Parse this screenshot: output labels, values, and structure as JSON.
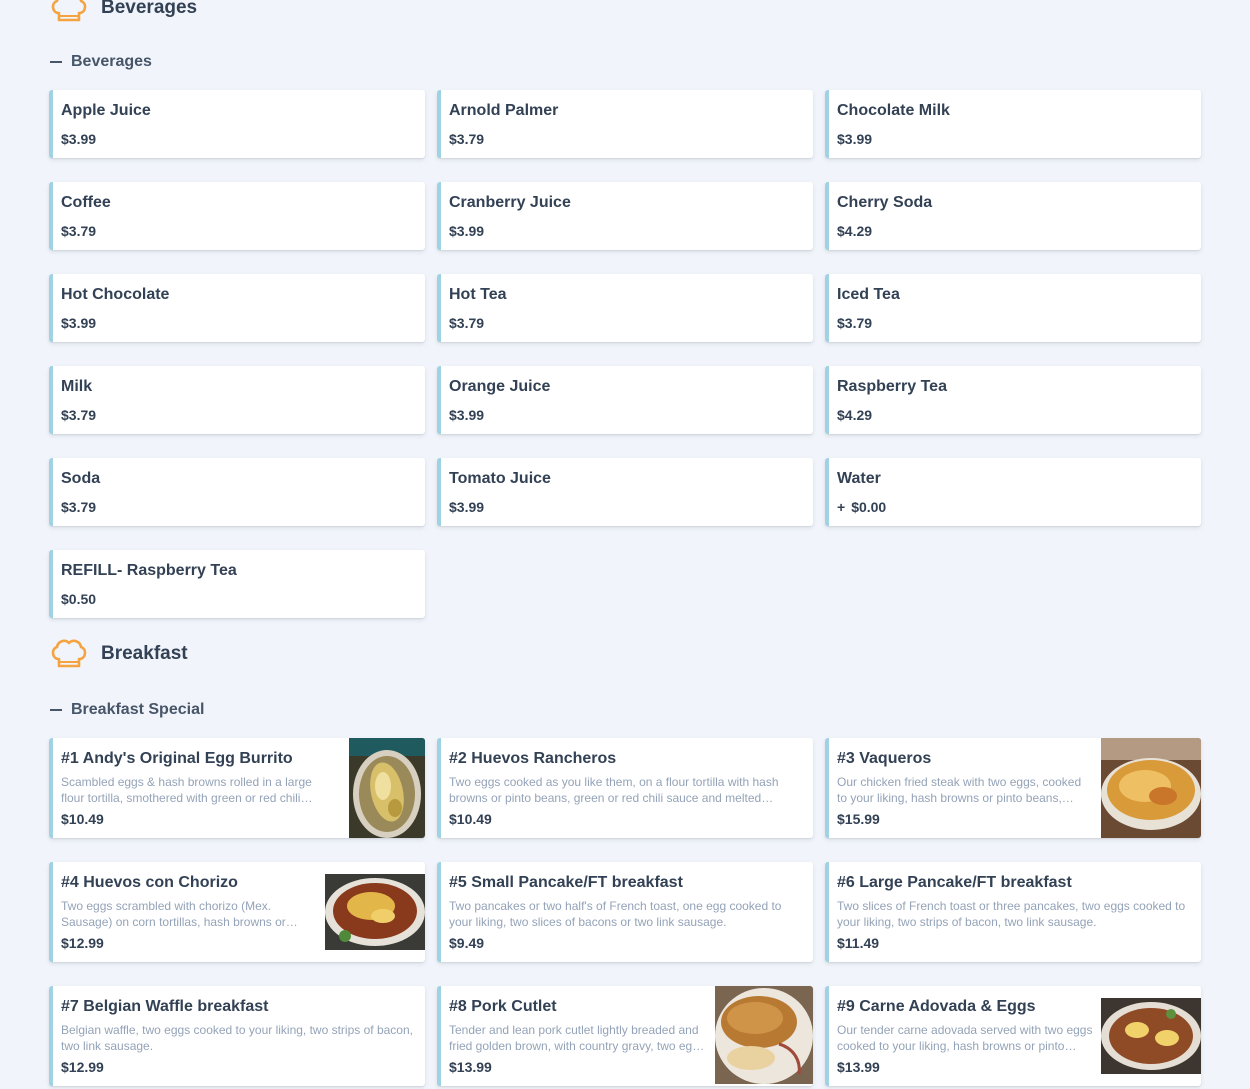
{
  "sections": {
    "beverages": {
      "title": "Beverages",
      "subcategory": "Beverages",
      "items": [
        {
          "name": "Apple Juice",
          "price": "$3.99"
        },
        {
          "name": "Arnold Palmer",
          "price": "$3.79"
        },
        {
          "name": "Chocolate Milk",
          "price": "$3.99"
        },
        {
          "name": "Coffee",
          "price": "$3.79"
        },
        {
          "name": "Cranberry Juice",
          "price": "$3.99"
        },
        {
          "name": "Cherry Soda",
          "price": "$4.29"
        },
        {
          "name": "Hot Chocolate",
          "price": "$3.99"
        },
        {
          "name": "Hot Tea",
          "price": "$3.79"
        },
        {
          "name": "Iced Tea",
          "price": "$3.79"
        },
        {
          "name": "Milk",
          "price": "$3.79"
        },
        {
          "name": "Orange Juice",
          "price": "$3.99"
        },
        {
          "name": "Raspberry Tea",
          "price": "$4.29"
        },
        {
          "name": "Soda",
          "price": "$3.79"
        },
        {
          "name": "Tomato Juice",
          "price": "$3.99"
        },
        {
          "name": "Water",
          "price_prefix": "+",
          "price": "$0.00"
        },
        {
          "name": "REFILL- Raspberry Tea",
          "price": "$0.50"
        }
      ]
    },
    "breakfast": {
      "title": "Breakfast",
      "subcategory": "Breakfast Special",
      "items": [
        {
          "name": "#1 Andy's Original Egg Burrito",
          "description": "Scambled eggs & hash browns rolled in a large flour tortilla, smothered with green or red chili sauce and melted cheese.",
          "price": "$10.49",
          "image": "egg-burrito-photo"
        },
        {
          "name": "#2 Huevos Rancheros",
          "description": "Two eggs cooked as you like them, on a flour tortilla with hash browns or pinto beans, green or red chili sauce and melted cheese.",
          "price": "$10.49"
        },
        {
          "name": "#3 Vaqueros",
          "description": "Our chicken fried steak with two eggs, cooked to your liking, hash browns or pinto beans, smothered in chili.",
          "price": "$15.99",
          "image": "vaqueros-photo"
        },
        {
          "name": "#4 Huevos con Chorizo",
          "description": "Two eggs scrambled with chorizo (Mex. Sausage) on corn tortillas, hash browns or pinto beans, smothered in chili.",
          "price": "$12.99",
          "image": "chorizo-photo"
        },
        {
          "name": "#5 Small Pancake/FT breakfast",
          "description": "Two pancakes or two half's of French toast, one egg cooked to your liking, two slices of bacons or two link sausage.",
          "price": "$9.49"
        },
        {
          "name": "#6 Large Pancake/FT breakfast",
          "description": "Two slices of French toast or three pancakes, two eggs cooked to your liking, two strips of bacon, two link sausage.",
          "price": "$11.49"
        },
        {
          "name": "#7 Belgian Waffle breakfast",
          "description": "Belgian waffle, two eggs cooked to your liking, two strips of bacon, two link sausage.",
          "price": "$12.99"
        },
        {
          "name": "#8 Pork Cutlet",
          "description": "Tender and lean pork cutlet lightly breaded and fried golden brown, with country gravy, two eggs and hash browns.",
          "price": "$13.99",
          "image": "pork-cutlet-photo"
        },
        {
          "name": "#9 Carne Adovada & Eggs",
          "description": "Our tender carne adovada served with two eggs cooked to your liking, hash browns or pinto beans and a tortilla.",
          "price": "$13.99",
          "image": "carne-adovada-photo"
        }
      ]
    }
  },
  "colors": {
    "background": "#f1f5fb",
    "card": "#ffffff",
    "card_accent": "#9fd3e4",
    "icon_orange": "#f4a340",
    "text": "#334155",
    "description": "#94a3b8"
  }
}
